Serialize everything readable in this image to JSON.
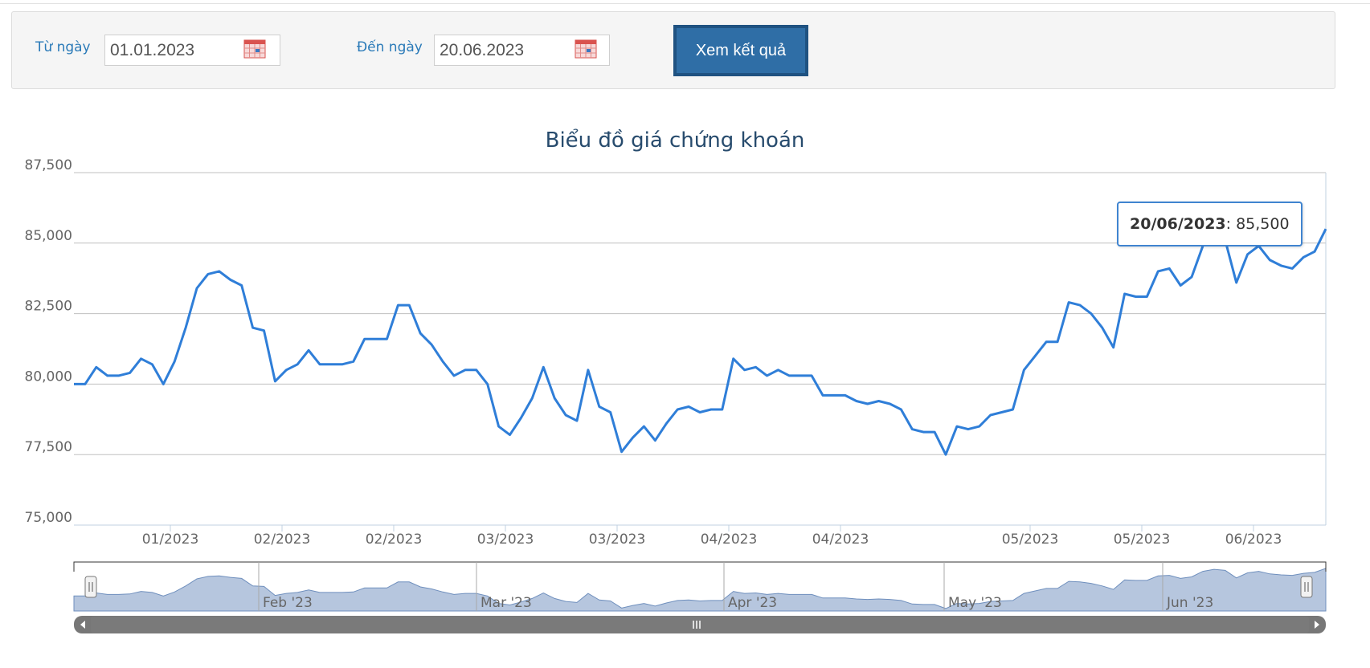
{
  "filter": {
    "from_label": "Từ ngày",
    "from_value": "01.01.2023",
    "to_label": "Đến ngày",
    "to_value": "20.06.2023",
    "submit_label": "Xem kết quả"
  },
  "tooltip": {
    "date": "20/06/2023",
    "sep": ":",
    "value": "85,500"
  },
  "navigator": {
    "labels": [
      "Feb '23",
      "Mar '23",
      "Apr '23",
      "May '23",
      "Jun '23"
    ]
  },
  "colors": {
    "line": "#2f7ed8",
    "navigator_fill": "#b6c6de",
    "navigator_line": "#6f8fbd",
    "button": "#2f6ea6"
  },
  "chart_data": {
    "type": "line",
    "title": "Biểu đồ giá chứng khoán",
    "ylim": [
      75000,
      87500
    ],
    "yticks": [
      "75,000",
      "77,500",
      "80,000",
      "82,500",
      "85,000",
      "87,500"
    ],
    "xticks": [
      "01/2023",
      "02/2023",
      "02/2023",
      "03/2023",
      "03/2023",
      "04/2023",
      "04/2023",
      "05/2023",
      "05/2023",
      "06/2023"
    ],
    "grid": true,
    "legend": "none",
    "series": [
      {
        "values": [
          80000,
          80000,
          80600,
          80300,
          80300,
          80400,
          80900,
          80700,
          80000,
          80800,
          82000,
          83400,
          83900,
          84000,
          83700,
          83500,
          82000,
          81900,
          80100,
          80500,
          80700,
          81200,
          80700,
          80700,
          80700,
          80800,
          81600,
          81600,
          81600,
          82800,
          82800,
          81800,
          81400,
          80800,
          80300,
          80500,
          80500,
          80000,
          78500,
          78200,
          78800,
          79500,
          80600,
          79500,
          78900,
          78700,
          80500,
          79200,
          79000,
          77600,
          78100,
          78500,
          78000,
          78600,
          79100,
          79200,
          79000,
          79100,
          79100,
          80900,
          80500,
          80600,
          80300,
          80500,
          80300,
          80300,
          80300,
          79600,
          79600,
          79600,
          79400,
          79300,
          79400,
          79300,
          79100,
          78400,
          78300,
          78300,
          77500,
          78500,
          78400,
          78500,
          78900,
          79000,
          79100,
          80500,
          81000,
          81500,
          81500,
          82900,
          82800,
          82500,
          82000,
          81300,
          83200,
          83100,
          83100,
          84000,
          84100,
          83500,
          83800,
          84900,
          85300,
          85100,
          83600,
          84600,
          84900,
          84400,
          84200,
          84100,
          84500,
          84700,
          85500
        ]
      }
    ]
  }
}
